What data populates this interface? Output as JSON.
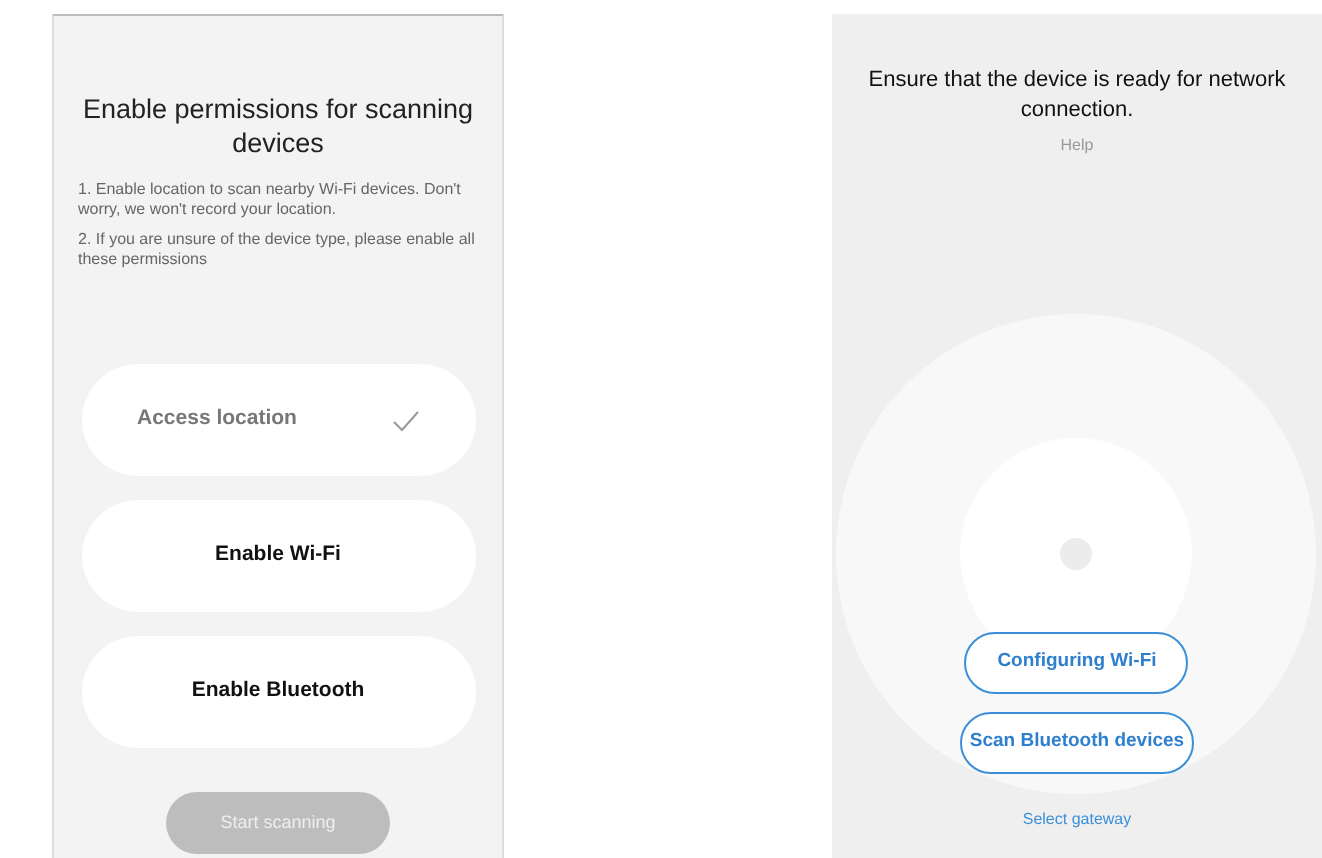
{
  "permissions_screen": {
    "title": "Enable permissions for scanning devices",
    "notes": [
      "1. Enable location to scan nearby Wi-Fi devices. Don't worry, we won't record your location.",
      "2. If you are unsure of the device type, please enable all these permissions"
    ],
    "permissions": [
      {
        "label": "Access location",
        "granted": true
      },
      {
        "label": "Enable Wi-Fi",
        "granted": false
      },
      {
        "label": "Enable Bluetooth",
        "granted": false
      }
    ],
    "start_button": {
      "label": "Start scanning",
      "disabled": true
    }
  },
  "connection_screen": {
    "title": "Ensure that the device is ready for network connection.",
    "help": "Help",
    "buttons": [
      "Configuring Wi-Fi",
      "Scan Bluetooth devices"
    ],
    "link": "Select gateway"
  }
}
